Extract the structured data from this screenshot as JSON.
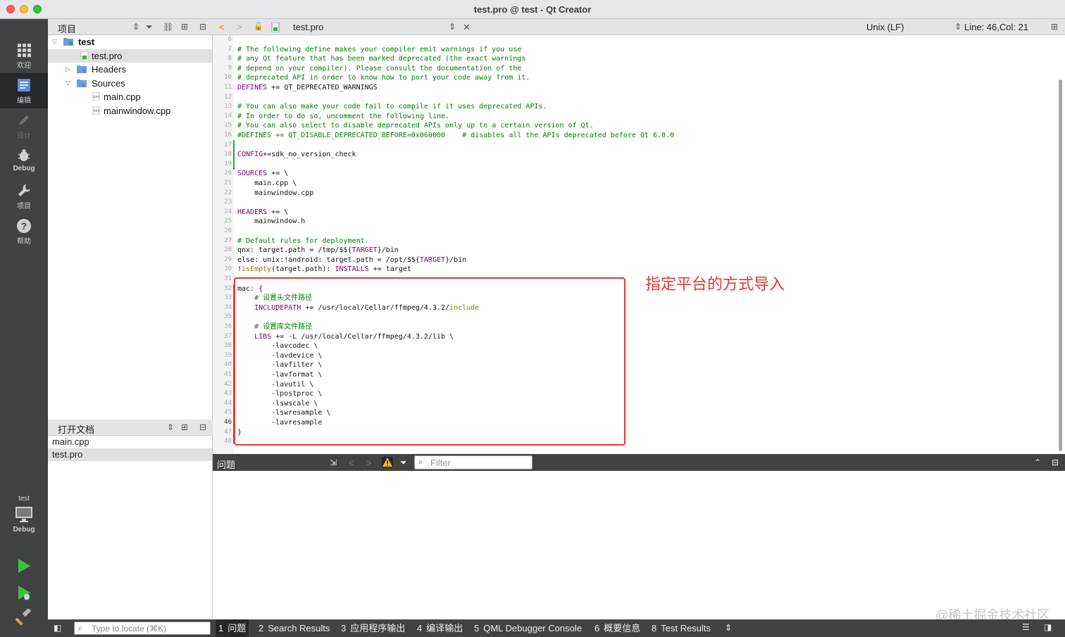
{
  "window": {
    "title": "test.pro @ test - Qt Creator"
  },
  "modes": [
    {
      "label": "欢迎",
      "icon": "welcome-grid-icon"
    },
    {
      "label": "编辑",
      "icon": "edit-icon"
    },
    {
      "label": "设计",
      "icon": "design-pen-icon"
    },
    {
      "label": "Debug",
      "icon": "debug-bug-icon"
    },
    {
      "label": "项目",
      "icon": "project-wrench-icon"
    },
    {
      "label": "帮助",
      "icon": "help-icon"
    }
  ],
  "kit": {
    "project": "test",
    "build": "Debug"
  },
  "projects_pane": {
    "title": "项目",
    "tree": [
      {
        "label": "test",
        "level": 0
      },
      {
        "label": "test.pro",
        "level": 1
      },
      {
        "label": "Headers",
        "level": 1
      },
      {
        "label": "Sources",
        "level": 1
      },
      {
        "label": "main.cpp",
        "level": 2
      },
      {
        "label": "mainwindow.cpp",
        "level": 2
      }
    ]
  },
  "open_docs": {
    "title": "打开文档",
    "items": [
      "main.cpp",
      "test.pro"
    ]
  },
  "editor_toolbar": {
    "file": "test.pro",
    "line_ending": "Unix (LF)",
    "position": "Line: 46,Col: 21"
  },
  "editor": {
    "lines": [
      {
        "n": "6",
        "t": ""
      },
      {
        "n": "7",
        "t": "# The following define makes your compiler emit warnings if you use"
      },
      {
        "n": "8",
        "t": "# any Qt feature that has been marked deprecated (the exact warnings"
      },
      {
        "n": "9",
        "t": "# depend on your compiler). Please consult the documentation of the"
      },
      {
        "n": "10",
        "t": "# deprecated API in order to know how to port your code away from it."
      },
      {
        "n": "11",
        "t": "DEFINES += QT_DEPRECATED_WARNINGS"
      },
      {
        "n": "12",
        "t": ""
      },
      {
        "n": "13",
        "t": "# You can also make your code fail to compile if it uses deprecated APIs."
      },
      {
        "n": "14",
        "t": "# In order to do so, uncomment the following line."
      },
      {
        "n": "15",
        "t": "# You can also select to disable deprecated APIs only up to a certain version of Qt."
      },
      {
        "n": "16",
        "t": "#DEFINES += QT_DISABLE_DEPRECATED_BEFORE=0x060000    # disables all the APIs deprecated before Qt 6.0.0"
      },
      {
        "n": "17",
        "t": ""
      },
      {
        "n": "18",
        "t": "CONFIG+=sdk_no_version_check"
      },
      {
        "n": "19",
        "t": ""
      },
      {
        "n": "20",
        "t": "SOURCES += \\"
      },
      {
        "n": "21",
        "t": "    main.cpp \\"
      },
      {
        "n": "22",
        "t": "    mainwindow.cpp"
      },
      {
        "n": "23",
        "t": ""
      },
      {
        "n": "24",
        "t": "HEADERS += \\"
      },
      {
        "n": "25",
        "t": "    mainwindow.h"
      },
      {
        "n": "26",
        "t": ""
      },
      {
        "n": "27",
        "t": "# Default rules for deployment."
      },
      {
        "n": "28",
        "t": "qnx: target.path = /tmp/$${TARGET}/bin"
      },
      {
        "n": "29",
        "t": "else: unix:!android: target.path = /opt/$${TARGET}/bin"
      },
      {
        "n": "30",
        "t": "!isEmpty(target.path): INSTALLS += target"
      },
      {
        "n": "31",
        "t": ""
      },
      {
        "n": "32",
        "t": "mac: {"
      },
      {
        "n": "33",
        "t": "    # 设置头文件路径"
      },
      {
        "n": "34",
        "t": "    INCLUDEPATH += /usr/local/Cellar/ffmpeg/4.3.2/include"
      },
      {
        "n": "35",
        "t": ""
      },
      {
        "n": "36",
        "t": "    # 设置库文件路径"
      },
      {
        "n": "37",
        "t": "    LIBS += -L /usr/local/Cellar/ffmpeg/4.3.2/lib \\"
      },
      {
        "n": "38",
        "t": "        -lavcodec \\"
      },
      {
        "n": "39",
        "t": "        -lavdevice \\"
      },
      {
        "n": "40",
        "t": "        -lavfilter \\"
      },
      {
        "n": "41",
        "t": "        -lavformat \\"
      },
      {
        "n": "42",
        "t": "        -lavutil \\"
      },
      {
        "n": "43",
        "t": "        -lpostproc \\"
      },
      {
        "n": "44",
        "t": "        -lswscale \\"
      },
      {
        "n": "45",
        "t": "        -lswresample \\"
      },
      {
        "n": "46",
        "t": "        -lavresample"
      },
      {
        "n": "47",
        "t": "}"
      },
      {
        "n": "48",
        "t": ""
      }
    ]
  },
  "annotation": {
    "text": "指定平台的方式导入",
    "color": "#e53935"
  },
  "issues": {
    "title": "问题",
    "filter_placeholder": "Filter"
  },
  "statusbar": {
    "locate_placeholder": "Type to locate (⌘K)",
    "tabs": [
      {
        "num": "1",
        "label": "问题"
      },
      {
        "num": "2",
        "label": "Search Results"
      },
      {
        "num": "3",
        "label": "应用程序输出"
      },
      {
        "num": "4",
        "label": "编译输出"
      },
      {
        "num": "5",
        "label": "QML Debugger Console"
      },
      {
        "num": "6",
        "label": "概要信息"
      },
      {
        "num": "8",
        "label": "Test Results"
      }
    ]
  },
  "watermark": "@稀土掘金技术社区"
}
